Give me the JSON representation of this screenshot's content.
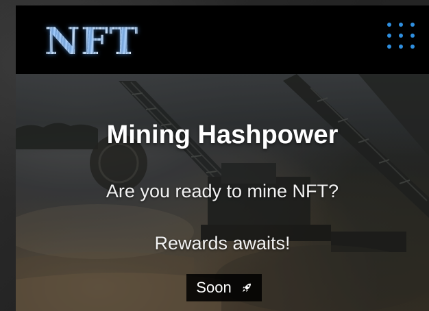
{
  "navbar": {
    "logo_text": "NFT",
    "menu_icon": "grid-dots-icon",
    "accent_color": "#2f8fe0"
  },
  "hero": {
    "title": "Mining Hashpower",
    "subtitle": "Are you ready to mine NFT?",
    "rewards_text": "Rewards awaits!",
    "cta_label": "Soon",
    "cta_icon": "rocket-icon"
  }
}
